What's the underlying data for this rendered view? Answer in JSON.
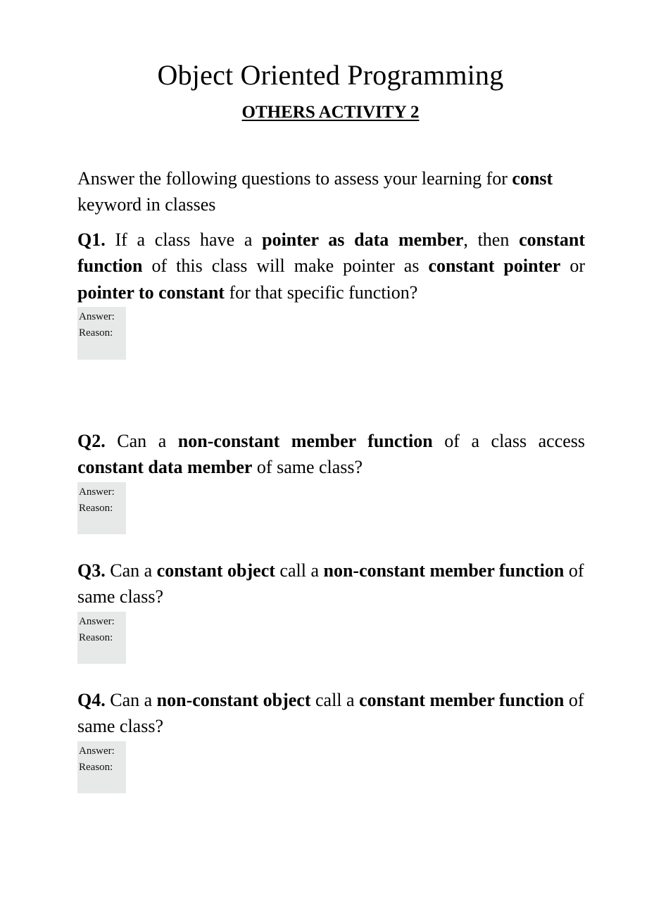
{
  "document": {
    "title": "Object Oriented Programming",
    "subtitle": "OTHERS ACTIVITY 2",
    "intro": {
      "part1": "Answer the following questions to assess your learning for ",
      "keyword": "const",
      "part2": " keyword in classes"
    },
    "field_labels": {
      "answer": "Answer:",
      "reason": "Reason:"
    },
    "colors": {
      "page_background": "#ffffff",
      "text": "#000000",
      "field_background": "#e7e8e8"
    },
    "questions": [
      {
        "label": "Q1.",
        "segments": [
          {
            "text": " If a class have a ",
            "bold": false
          },
          {
            "text": "pointer as data member",
            "bold": true
          },
          {
            "text": ", then ",
            "bold": false
          },
          {
            "text": "constant function",
            "bold": true
          },
          {
            "text": " of this class will make pointer as ",
            "bold": false
          },
          {
            "text": "constant pointer",
            "bold": true
          },
          {
            "text": " or ",
            "bold": false
          },
          {
            "text": "pointer to constant",
            "bold": true
          },
          {
            "text": " for that specific function?",
            "bold": false
          }
        ]
      },
      {
        "label": "Q2.",
        "segments": [
          {
            "text": " Can a ",
            "bold": false
          },
          {
            "text": "non-constant member function",
            "bold": true
          },
          {
            "text": " of a class access ",
            "bold": false
          },
          {
            "text": "constant data member",
            "bold": true
          },
          {
            "text": " of same class?",
            "bold": false
          }
        ]
      },
      {
        "label": "Q3.",
        "segments": [
          {
            "text": " Can a ",
            "bold": false
          },
          {
            "text": "constant object",
            "bold": true
          },
          {
            "text": " call a ",
            "bold": false
          },
          {
            "text": "non-constant member function",
            "bold": true
          },
          {
            "text": " of same class?",
            "bold": false
          }
        ]
      },
      {
        "label": "Q4.",
        "segments": [
          {
            "text": " Can a ",
            "bold": false
          },
          {
            "text": "non-constant object",
            "bold": true
          },
          {
            "text": " call a ",
            "bold": false
          },
          {
            "text": "constant member function",
            "bold": true
          },
          {
            "text": " of same class?",
            "bold": false
          }
        ]
      }
    ]
  }
}
